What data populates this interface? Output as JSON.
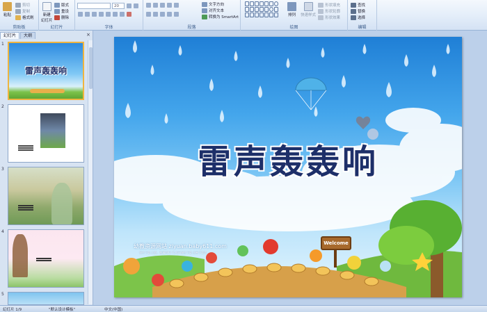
{
  "ribbon": {
    "clipboard": {
      "paste": "粘贴",
      "cut": "剪切",
      "copy": "复制",
      "format_painter": "格式刷",
      "label": "剪贴板"
    },
    "slides": {
      "new_slide": "新建\n幻灯片",
      "layout": "版式",
      "reset": "重设",
      "delete": "删除",
      "label": "幻灯片"
    },
    "font": {
      "size": "20",
      "label": "字体"
    },
    "paragraph": {
      "text_direction": "文字方向",
      "align_text": "对齐文本",
      "smartart": "转换为 SmartArt",
      "label": "段落"
    },
    "drawing": {
      "arrange": "排列",
      "quick_styles": "快速样式",
      "shape_fill": "形状填充",
      "shape_outline": "形状轮廓",
      "shape_effects": "形状效果",
      "label": "绘图"
    },
    "editing": {
      "find": "查找",
      "replace": "替换",
      "select": "选择",
      "label": "编辑"
    }
  },
  "panel": {
    "tab_slides": "幻灯片",
    "tab_outline": "大纲",
    "close": "×"
  },
  "thumbnails": [
    {
      "num": "1",
      "text": "雷声轰轰响"
    },
    {
      "num": "2",
      "text": ""
    },
    {
      "num": "3",
      "text": ""
    },
    {
      "num": "4",
      "text": ""
    },
    {
      "num": "5",
      "text": ""
    }
  ],
  "slide": {
    "title": "雷声轰轰响",
    "site": "幼教资源网站  ziyuan.baby611.com",
    "site_sub": "课件下载   儿歌、故事MP3   FLASH课件下载   试卷下载等",
    "welcome": "Welcome"
  },
  "status": {
    "slide_info": "幻灯片 1/9",
    "theme": "\"默认设计模板\"",
    "language": "中文(中国)"
  },
  "colors": {
    "title": "#1d2f69",
    "sky_top": "#1f7fd6",
    "selected_border": "#f0b43e"
  }
}
